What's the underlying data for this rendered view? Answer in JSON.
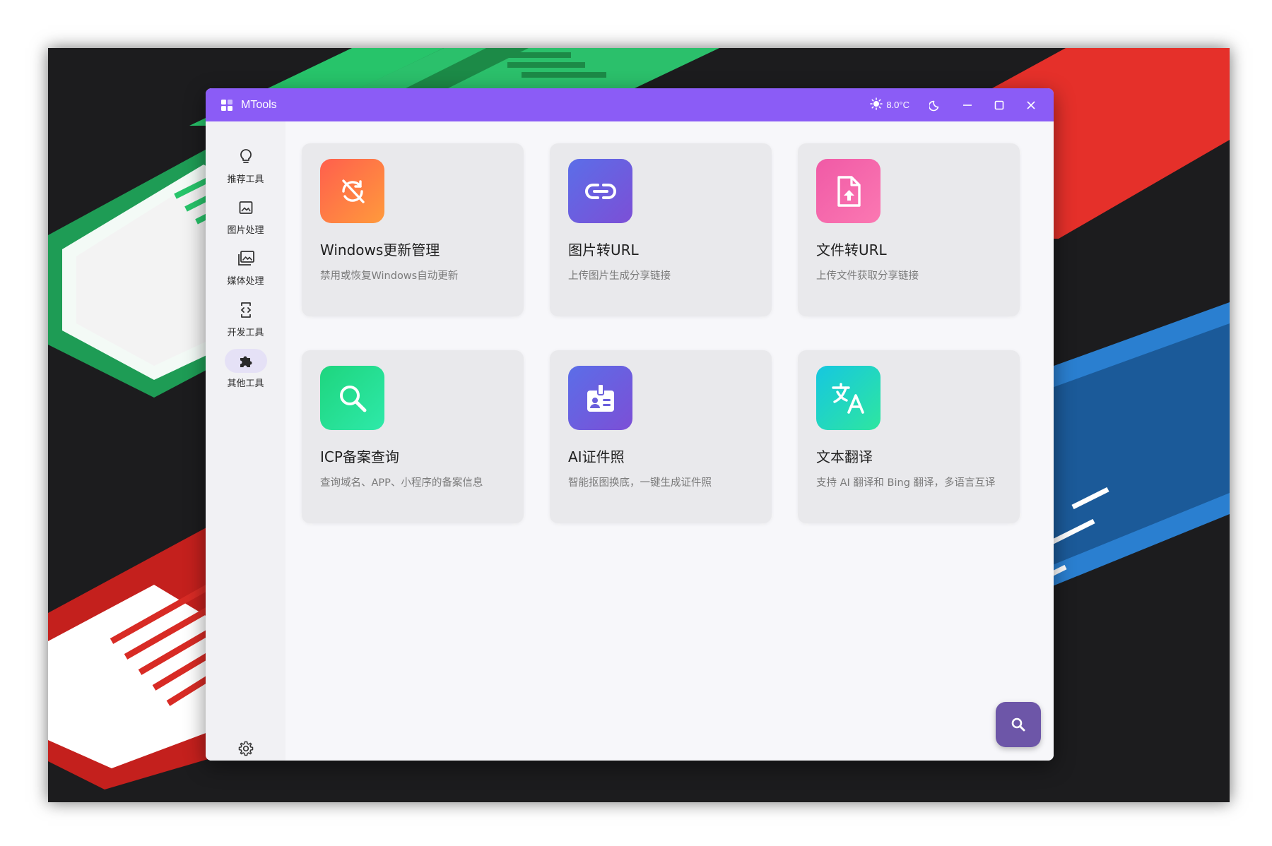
{
  "window": {
    "title": "MTools",
    "weather_temp": "8.0°C"
  },
  "sidebar": {
    "items": [
      {
        "label": "推荐工具",
        "icon": "lightbulb-icon"
      },
      {
        "label": "图片处理",
        "icon": "image-icon"
      },
      {
        "label": "媒体处理",
        "icon": "media-gallery-icon"
      },
      {
        "label": "开发工具",
        "icon": "code-file-icon"
      },
      {
        "label": "其他工具",
        "icon": "puzzle-icon",
        "active": true
      }
    ],
    "settings_icon": "gear-icon"
  },
  "tools": [
    {
      "title": "Windows更新管理",
      "desc": "禁用或恢复Windows自动更新",
      "icon": "update-off-icon",
      "gradient": [
        "#ff5f4d",
        "#ff9a3c"
      ]
    },
    {
      "title": "图片转URL",
      "desc": "上传图片生成分享链接",
      "icon": "link-icon",
      "gradient": [
        "#5b6ee8",
        "#7c4fd6"
      ]
    },
    {
      "title": "文件转URL",
      "desc": "上传文件获取分享链接",
      "icon": "file-upload-icon",
      "gradient": [
        "#f05aa6",
        "#fb78b2"
      ]
    },
    {
      "title": "ICP备案查询",
      "desc": "查询域名、APP、小程序的备案信息",
      "icon": "search-icon",
      "gradient": [
        "#1ed57e",
        "#2ee9a9"
      ]
    },
    {
      "title": "AI证件照",
      "desc": "智能抠图换底，一键生成证件照",
      "icon": "id-badge-icon",
      "gradient": [
        "#5b6ee8",
        "#7c4fd6"
      ]
    },
    {
      "title": "文本翻译",
      "desc": "支持 AI 翻译和 Bing 翻译，多语言互译",
      "icon": "translate-icon",
      "gradient": [
        "#16c7e0",
        "#2ee6a0"
      ]
    }
  ],
  "fab": {
    "icon": "search-icon"
  },
  "colors": {
    "titlebar": "#8b5cf6",
    "active_nav": "#e5e1f6",
    "fab": "#6d56a8"
  }
}
